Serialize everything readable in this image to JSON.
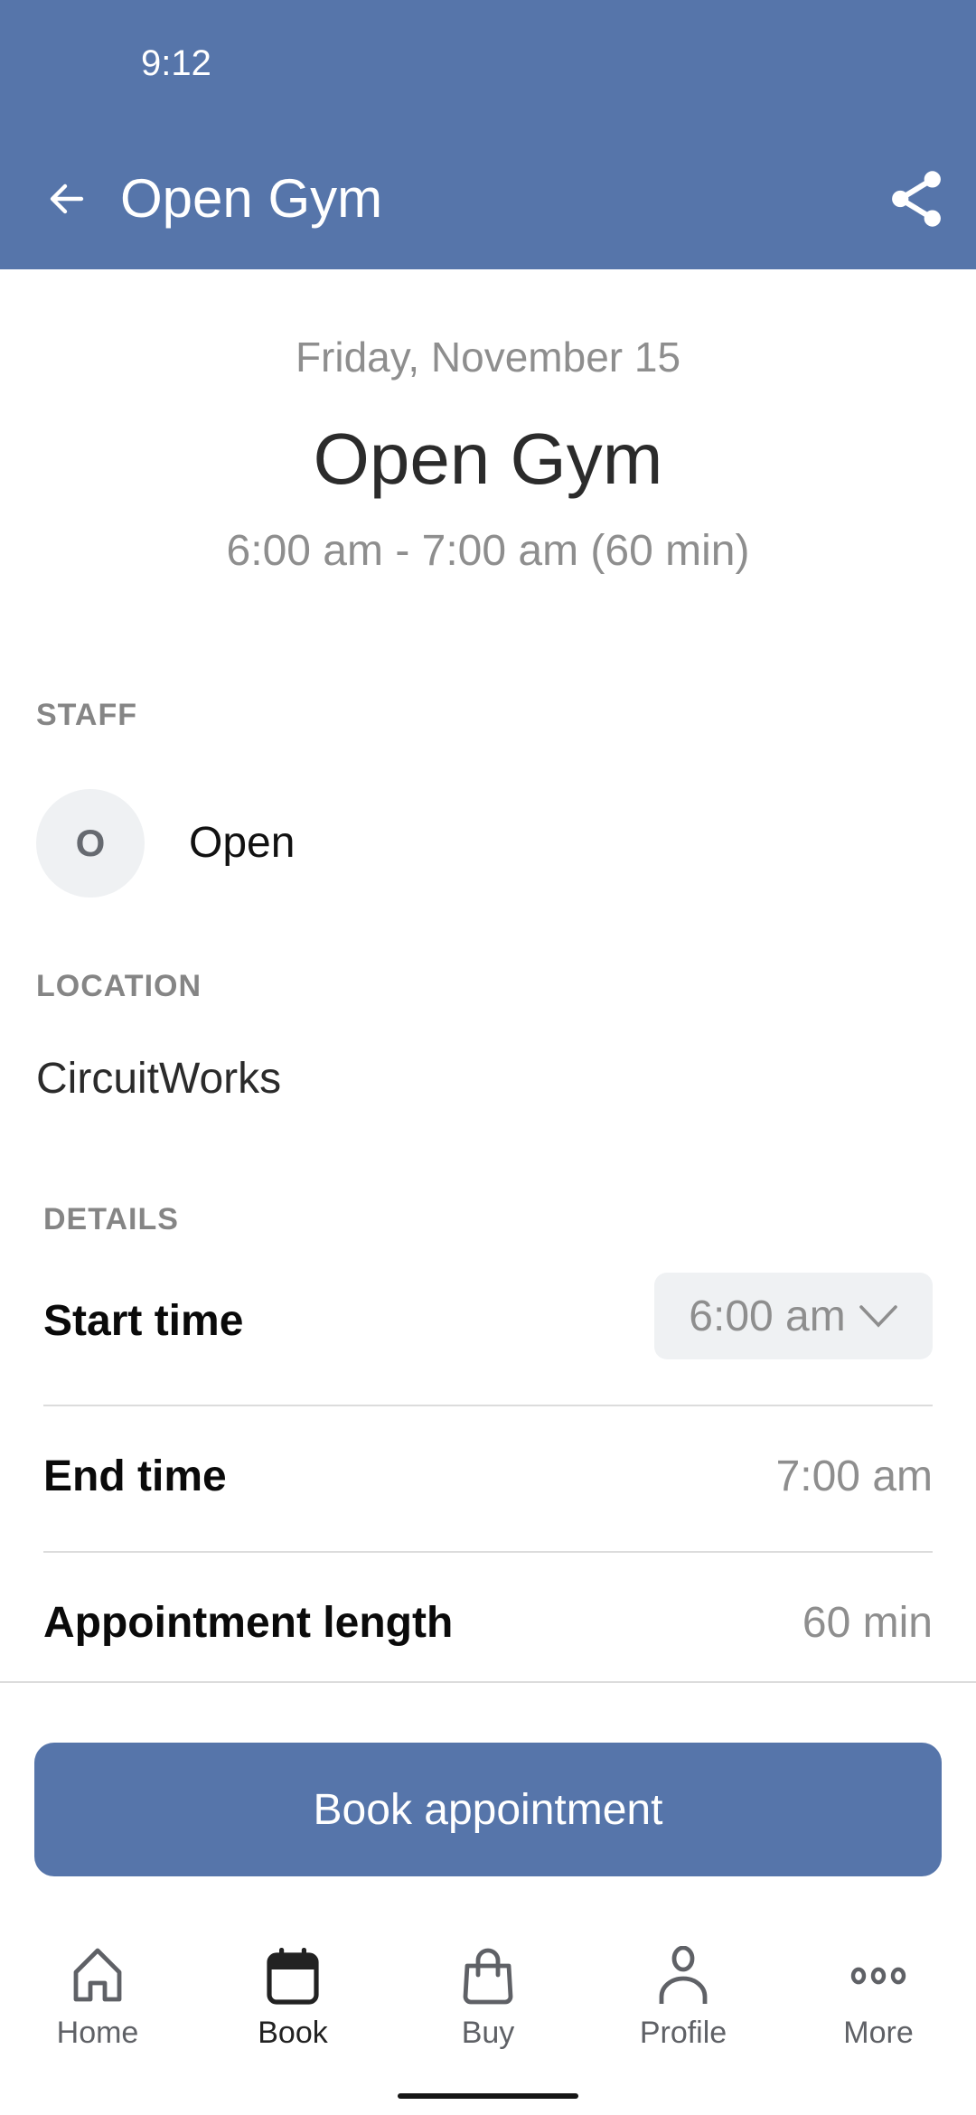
{
  "status_bar": {
    "time": "9:12"
  },
  "app_bar": {
    "title": "Open Gym",
    "back_icon": "arrow-left-icon",
    "share_icon": "share-icon"
  },
  "header": {
    "date": "Friday, November 15",
    "title": "Open Gym",
    "time_range": "6:00 am - 7:00 am (60 min)"
  },
  "staff": {
    "label": "STAFF",
    "avatar_initial": "O",
    "name": "Open"
  },
  "location": {
    "label": "LOCATION",
    "value": "CircuitWorks"
  },
  "details": {
    "label": "DETAILS",
    "rows": [
      {
        "key": "Start time",
        "value": "6:00 am",
        "type": "select"
      },
      {
        "key": "End time",
        "value": "7:00 am"
      },
      {
        "key": "Appointment length",
        "value": "60 min"
      }
    ]
  },
  "book_button": {
    "label": "Book appointment"
  },
  "bottom_nav": {
    "items": [
      {
        "label": "Home",
        "icon": "home-icon",
        "active": false
      },
      {
        "label": "Book",
        "icon": "calendar-icon",
        "active": true
      },
      {
        "label": "Buy",
        "icon": "shopping-bag-icon",
        "active": false
      },
      {
        "label": "Profile",
        "icon": "person-icon",
        "active": false
      },
      {
        "label": "More",
        "icon": "more-dots-icon",
        "active": false
      }
    ]
  },
  "colors": {
    "primary": "#5675aa",
    "secondary_text": "#8e8e8e",
    "chip_bg": "#eff1f3"
  }
}
